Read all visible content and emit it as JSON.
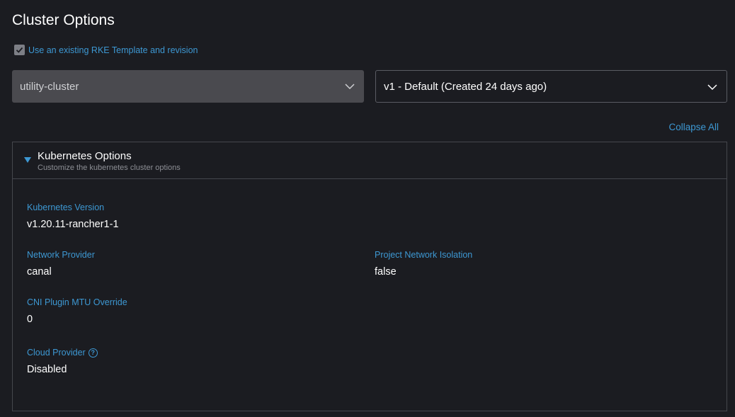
{
  "page": {
    "title": "Cluster Options"
  },
  "template": {
    "checkbox_label": "Use an existing RKE Template and revision",
    "checked": true,
    "template_value": "utility-cluster",
    "revision_value": "v1 - Default (Created 24 days ago)"
  },
  "actions": {
    "collapse_all": "Collapse All"
  },
  "kubernetes_options": {
    "title": "Kubernetes Options",
    "subtitle": "Customize the kubernetes cluster options",
    "fields": {
      "kubernetes_version": {
        "label": "Kubernetes Version",
        "value": "v1.20.11-rancher1-1"
      },
      "network_provider": {
        "label": "Network Provider",
        "value": "canal"
      },
      "project_network_isolation": {
        "label": "Project Network Isolation",
        "value": "false"
      },
      "cni_mtu": {
        "label": "CNI Plugin MTU Override",
        "value": "0"
      },
      "cloud_provider": {
        "label": "Cloud Provider",
        "value": "Disabled",
        "help_icon": "help-circle-icon"
      }
    }
  },
  "colors": {
    "accent": "#3d98d3",
    "background": "#1b1c21",
    "border": "#45474d"
  }
}
